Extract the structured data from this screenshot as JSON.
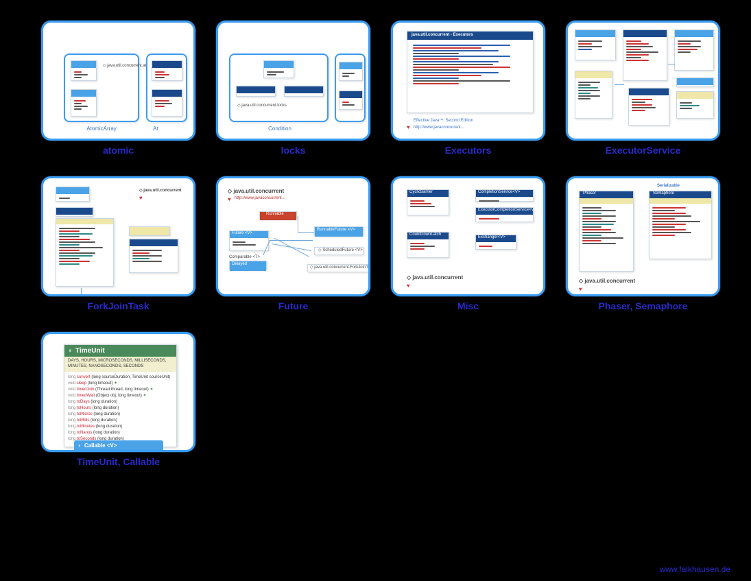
{
  "cards": [
    {
      "label": "atomic",
      "sublabel": "AtomicArray"
    },
    {
      "label": "locks",
      "sublabel": "Condition"
    },
    {
      "label": "Executors",
      "sublabel": ""
    },
    {
      "label": "ExecutorService",
      "sublabel": ""
    },
    {
      "label": "ForkJoinTask",
      "sublabel": ""
    },
    {
      "label": "Future",
      "sublabel": ""
    },
    {
      "label": "Misc",
      "sublabel": ""
    },
    {
      "label": "Phaser, Semaphore",
      "sublabel": ""
    },
    {
      "label": "TimeUnit, Callable",
      "sublabel": ""
    }
  ],
  "package_label": "java.util.concurrent",
  "package_locks_label": "java.util.concurrent.locks",
  "executors_title": "java.util.concurrent - Executors",
  "future": {
    "runnable": "Runnable",
    "future": "Future <V>",
    "runnable_future": "RunnableFuture <V>",
    "scheduled_future": "ScheduledFuture <V>",
    "forkjointask": "java.util.concurrent.ForkJoinTask",
    "delayed": "Delayed",
    "comparable": "Comparable <T>"
  },
  "misc": {
    "cyclic": "CyclicBarrier",
    "completion": "CompletionService<V>",
    "executor_completion": "ExecutorCompletionService<V>",
    "countdown": "CountDownLatch",
    "exchanger": "Exchanger<V>"
  },
  "phaser": {
    "phaser": "Phaser",
    "semaphore": "Semaphore"
  },
  "timeunit": {
    "title": "TimeUnit",
    "units": "DAYS, HOURS, MICROSECONDS, MILLISECONDS, MINUTES, NANOSECONDS, SECONDS",
    "rows": [
      {
        "t": "long",
        "m": "convert",
        "p": "(long sourceDuration, TimeUnit sourceUnit)"
      },
      {
        "t": "void",
        "m": "sleep",
        "p": "(long timeout)",
        "k": "✶"
      },
      {
        "t": "void",
        "m": "timedJoin",
        "p": "(Thread thread, long timeout)",
        "k": "✶"
      },
      {
        "t": "void",
        "m": "timedWait",
        "p": "(Object obj, long timeout)",
        "k": "✶"
      },
      {
        "t": "long",
        "m": "toDays",
        "p": "(long duration)"
      },
      {
        "t": "long",
        "m": "toHours",
        "p": "(long duration)"
      },
      {
        "t": "long",
        "m": "toMicros",
        "p": "(long duration)"
      },
      {
        "t": "long",
        "m": "toMillis",
        "p": "(long duration)"
      },
      {
        "t": "long",
        "m": "toMinutes",
        "p": "(long duration)"
      },
      {
        "t": "long",
        "m": "toNanos",
        "p": "(long duration)"
      },
      {
        "t": "long",
        "m": "toSeconds",
        "p": "(long duration)"
      }
    ],
    "callable": "Callable <V>"
  },
  "footer": "www.falkhausen.de"
}
